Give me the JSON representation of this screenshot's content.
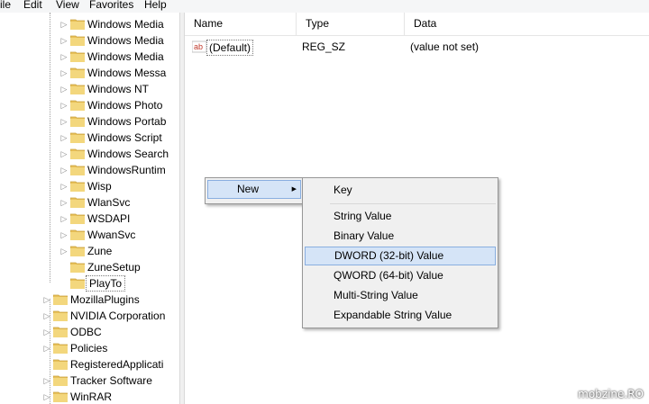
{
  "menubar": {
    "file": "ile",
    "edit": "Edit",
    "view": "View",
    "favorites": "Favorites",
    "help": "Help"
  },
  "tree": {
    "sub_items": [
      "Windows Media",
      "Windows Media",
      "Windows Media",
      "Windows Messa",
      "Windows NT",
      "Windows Photo",
      "Windows Portab",
      "Windows Script",
      "Windows Search",
      "WindowsRuntim",
      "Wisp",
      "WlanSvc",
      "WSDAPI",
      "WwanSvc",
      "Zune",
      "ZuneSetup",
      "PlayTo"
    ],
    "top_items": [
      "MozillaPlugins",
      "NVIDIA Corporation",
      "ODBC",
      "Policies",
      "RegisteredApplicati",
      "Tracker Software",
      "WinRAR"
    ]
  },
  "list": {
    "headers": {
      "name": "Name",
      "type": "Type",
      "data": "Data"
    },
    "rows": [
      {
        "icon": "ab",
        "name": "(Default)",
        "type": "REG_SZ",
        "data": "(value not set)"
      }
    ]
  },
  "context_menu": {
    "new_label": "New",
    "new_arrow": "▶"
  },
  "submenu": {
    "items": [
      "Key",
      "String Value",
      "Binary Value",
      "DWORD (32-bit) Value",
      "QWORD (64-bit) Value",
      "Multi-String Value",
      "Expandable String Value"
    ]
  },
  "watermark": "mobzine.RO",
  "colors": {
    "highlight_bg": "#d5e4f7",
    "highlight_border": "#89aee0",
    "folder": "#e8c15a"
  }
}
